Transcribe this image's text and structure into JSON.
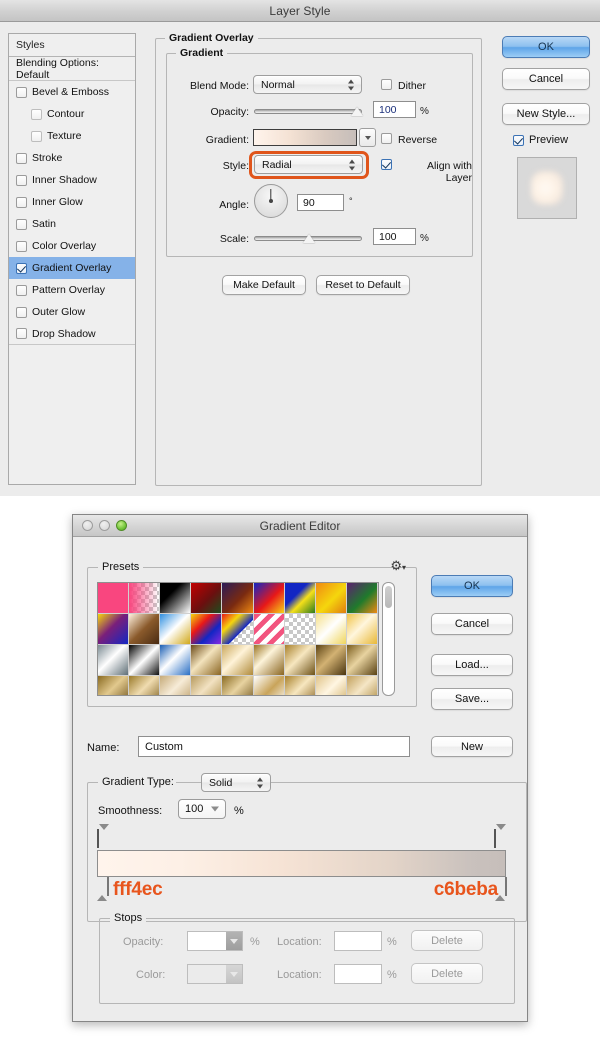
{
  "layer_style": {
    "title": "Layer Style",
    "styles_header": "Styles",
    "blending_options": "Blending Options: Default",
    "effects": [
      {
        "label": "Bevel & Emboss",
        "checked": false,
        "indent": false,
        "selected": false
      },
      {
        "label": "Contour",
        "checked": false,
        "indent": true,
        "selected": false
      },
      {
        "label": "Texture",
        "checked": false,
        "indent": true,
        "selected": false
      },
      {
        "label": "Stroke",
        "checked": false,
        "indent": false,
        "selected": false
      },
      {
        "label": "Inner Shadow",
        "checked": false,
        "indent": false,
        "selected": false
      },
      {
        "label": "Inner Glow",
        "checked": false,
        "indent": false,
        "selected": false
      },
      {
        "label": "Satin",
        "checked": false,
        "indent": false,
        "selected": false
      },
      {
        "label": "Color Overlay",
        "checked": false,
        "indent": false,
        "selected": false
      },
      {
        "label": "Gradient Overlay",
        "checked": true,
        "indent": false,
        "selected": true
      },
      {
        "label": "Pattern Overlay",
        "checked": false,
        "indent": false,
        "selected": false
      },
      {
        "label": "Outer Glow",
        "checked": false,
        "indent": false,
        "selected": false
      },
      {
        "label": "Drop Shadow",
        "checked": false,
        "indent": false,
        "selected": false
      }
    ],
    "panel": {
      "outer_legend": "Gradient Overlay",
      "inner_legend": "Gradient",
      "blend_mode_label": "Blend Mode:",
      "blend_mode_value": "Normal",
      "dither_label": "Dither",
      "dither_checked": false,
      "opacity_label": "Opacity:",
      "opacity_value": "100",
      "opacity_unit": "%",
      "gradient_label": "Gradient:",
      "reverse_label": "Reverse",
      "reverse_checked": false,
      "style_label": "Style:",
      "style_value": "Radial",
      "style_highlight_color": "#e0551b",
      "align_label": "Align with Layer",
      "align_checked": true,
      "angle_label": "Angle:",
      "angle_value": "90",
      "angle_unit": "°",
      "scale_label": "Scale:",
      "scale_value": "100",
      "scale_unit": "%",
      "make_default": "Make Default",
      "reset_default": "Reset to Default",
      "gradient_from": "#fff4ec",
      "gradient_to": "#c6beba"
    },
    "buttons": {
      "ok": "OK",
      "cancel": "Cancel",
      "new_style": "New Style...",
      "preview_label": "Preview",
      "preview_checked": true
    }
  },
  "gradient_editor": {
    "title": "Gradient Editor",
    "presets_legend": "Presets",
    "buttons": {
      "ok": "OK",
      "cancel": "Cancel",
      "load": "Load...",
      "save": "Save...",
      "new": "New"
    },
    "name_label": "Name:",
    "name_value": "Custom",
    "gradient_type_label": "Gradient Type:",
    "gradient_type_value": "Solid",
    "smoothness_label": "Smoothness:",
    "smoothness_value": "100",
    "smoothness_unit": "%",
    "stop_left_hex": "fff4ec",
    "stop_right_hex": "c6beba",
    "stops_legend": "Stops",
    "opacity_label": "Opacity:",
    "opacity_unit": "%",
    "location_label_1": "Location:",
    "location_unit_1": "%",
    "delete_1": "Delete",
    "color_label": "Color:",
    "location_label_2": "Location:",
    "location_unit_2": "%",
    "delete_2": "Delete",
    "presets": [
      "linear-gradient(135deg,#f9467f,#f9467f)",
      "checker-pink",
      "linear-gradient(to bottom right,#000 0%,#000 35%,#fff 100%)",
      "linear-gradient(135deg,#c30000,#6b0f0f 55%,#1e4d1e)",
      "linear-gradient(135deg,#2b1b58,#7a2a10 55%,#f08a12)",
      "linear-gradient(135deg,#1226c4,#e81818 55%,#f7d417)",
      "linear-gradient(135deg,#1226c4,#1226c4 38%,#f5e01a 60%,#2c7a1d)",
      "linear-gradient(135deg,#f08a12,#f5d60d 55%,#e07d10)",
      "linear-gradient(135deg,#5c2071,#1f7a2c 55%,#f08a12)",
      "linear-gradient(135deg,#f5d60d,#7a1f7a 45%,#1226c4)",
      "linear-gradient(135deg,#fff0dd,#8a5a2b 50%,#4a2b12)",
      "linear-gradient(135deg,#2f8fe0,#ffffff 48%,#d1a81a)",
      "linear-gradient(135deg,#f5d60d,#e81818 35%,#1226c4 65%,#8a2be2)",
      "rainbow-checker",
      "pink-stripe",
      "checker-plain",
      "linear-gradient(135deg,#f5e08a,#ffffff 48%,#efd55c)",
      "linear-gradient(135deg,#f0c44a,#fff6dd 45%,#e8b837)",
      "linear-gradient(135deg,#7b8b93,#ffffff 45%,#5f6f77)",
      "linear-gradient(135deg,#000000,#ffffff 50%,#101010)",
      "linear-gradient(135deg,#1a5fb4,#ffffff 45%,#2a6fc4)",
      "linear-gradient(135deg,#6b4a18,#f3e3bd 45%,#8a6522)",
      "linear-gradient(135deg,#caa85e,#fff3d8 45%,#b08a3a)",
      "linear-gradient(135deg,#9a7424,#fdf4da 40%,#8a6520)",
      "linear-gradient(135deg,#a8812c,#f7e7c0 45%,#6e5218)",
      "linear-gradient(135deg,#5d4414,#d3b273 45%,#4a3510)",
      "linear-gradient(135deg,#7a5c1c,#e8d3a0 45%,#5a4214)",
      "linear-gradient(135deg,#8a6b22,#e2c98e 45%,#6b4f18)",
      "linear-gradient(135deg,#9a7a2a,#f0dcb0 45%,#7a5c1c)",
      "linear-gradient(135deg,#c6ab7a,#f7ecd8 45%,#b99a63)",
      "linear-gradient(135deg,#b79a5e,#f2e2c2 45%,#a8873f)",
      "linear-gradient(135deg,#8a6b22,#e8d3a0 45%,#6b4f18)",
      "linear-gradient(135deg,#ffffff,#c9a45a 50%,#ffffff)",
      "linear-gradient(135deg,#a8812c,#f7e7c0 45%,#8a6522)",
      "linear-gradient(135deg,#e0c48a,#fff6e2 45%,#cfae66)",
      "linear-gradient(135deg,#c2a05c,#f5e6c6 45%,#a8863c)"
    ]
  }
}
